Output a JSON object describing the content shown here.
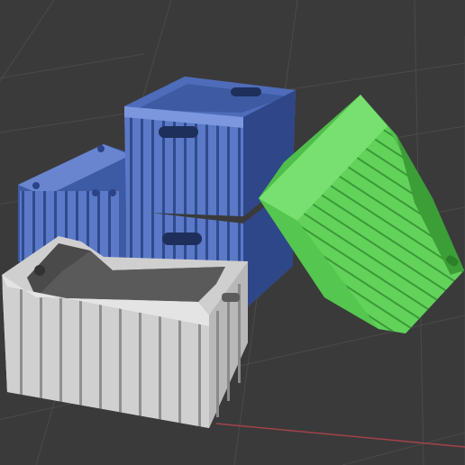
{
  "viewport": {
    "background": "#3a3a3a",
    "grid_color": "#4a4a4a",
    "x_axis_color": "#a4424b"
  },
  "objects": [
    {
      "id": "gray-crate",
      "color": "#d2d2d2",
      "state": "selected-active"
    },
    {
      "id": "blue-crate-upper",
      "color": "#5b79c6"
    },
    {
      "id": "blue-crate-lower",
      "color": "#5b79c6"
    },
    {
      "id": "blue-crate-back",
      "color": "#5b79c6"
    },
    {
      "id": "green-crate",
      "color": "#60cf5a",
      "state": "tilted"
    }
  ]
}
